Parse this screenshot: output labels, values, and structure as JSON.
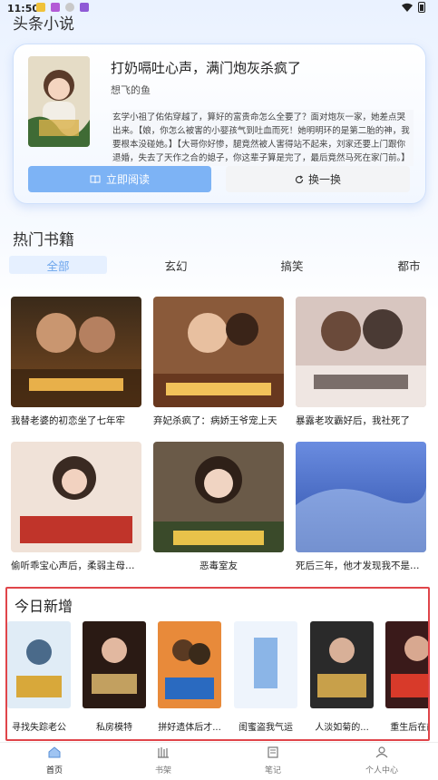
{
  "status_bar": {
    "time": "11:50"
  },
  "app": {
    "title": "头条小说"
  },
  "featured": {
    "title": "打奶嗝吐心声，满门炮灰杀疯了",
    "author": "想飞的鱼",
    "description": "玄学小祖了佑佑穿越了，算好的富贵命怎么全要了？面对炮灰一家，她差点哭出来。【娘，你怎么被害的小婴孩气到吐血而死！她明明环的是第二胎的神，我要根本没碰她。】【大哥你好惨，腿竟然被人害得站不起来，刘家还要上门跟你退婚，失去了天作之合的媳子，你这辈子算是完了，最后竟然马死在家门前。】",
    "read_label": "立即阅读",
    "swap_label": "换一换"
  },
  "hot_section": {
    "title": "热门书籍",
    "tabs": [
      "全部",
      "玄幻",
      "搞笑",
      "都市"
    ],
    "books": [
      {
        "title": "我替老婆的初恋坐了七年牢"
      },
      {
        "title": "弃妃杀疯了：病娇王爷宠上天"
      },
      {
        "title": "暴露老攻霸好后，我社死了"
      },
      {
        "title": "偷听乖宝心声后，柔弱主母杀疯了"
      },
      {
        "title": "恶毒室友"
      },
      {
        "title": "死后三年，他才发现我不是白月光"
      }
    ]
  },
  "today_section": {
    "title": "今日新增",
    "items": [
      {
        "label": "寻找失踪老公"
      },
      {
        "label": "私房模特"
      },
      {
        "label": "拼好遗体后才..."
      },
      {
        "label": "闺蜜盗我气运"
      },
      {
        "label": "人淡如菊的..."
      },
      {
        "label": "重生后在前..."
      }
    ]
  },
  "bottom_nav": {
    "items": [
      {
        "label": "首页"
      },
      {
        "label": "书架"
      },
      {
        "label": "笔记"
      },
      {
        "label": "个人中心"
      }
    ]
  },
  "colors": {
    "accent": "#7db3f5",
    "tab_active_bg": "#e6f0ff",
    "highlight_border": "#e0454a"
  }
}
